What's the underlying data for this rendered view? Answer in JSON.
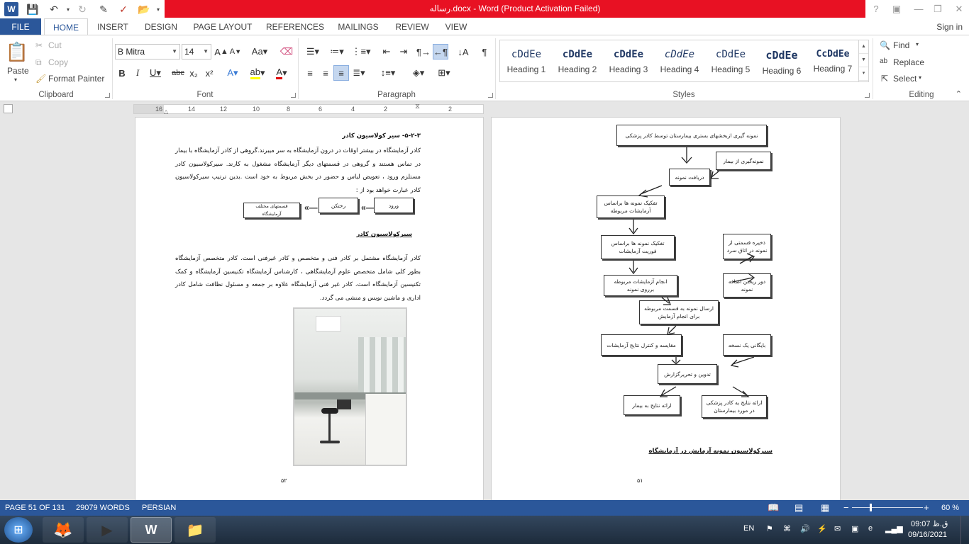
{
  "window": {
    "title": "رساله.docx -  Word (Product Activation Failed)",
    "help": "?",
    "restore_ribbon": "▣",
    "minimize": "—",
    "maximize": "❐",
    "close": "✕"
  },
  "tabs": [
    {
      "label": "FILE"
    },
    {
      "label": "HOME"
    },
    {
      "label": "INSERT"
    },
    {
      "label": "DESIGN"
    },
    {
      "label": "PAGE LAYOUT"
    },
    {
      "label": "REFERENCES"
    },
    {
      "label": "MAILINGS"
    },
    {
      "label": "REVIEW"
    },
    {
      "label": "VIEW"
    }
  ],
  "signin": "Sign in",
  "clipboard": {
    "paste": "Paste",
    "cut": "Cut",
    "copy": "Copy",
    "format_painter": "Format Painter",
    "group": "Clipboard"
  },
  "font": {
    "name": "B Mitra",
    "size": "14",
    "group": "Font"
  },
  "paragraph": {
    "group": "Paragraph"
  },
  "styles": {
    "group": "Styles",
    "items": [
      {
        "preview": "cDdEe",
        "name": "Heading 1"
      },
      {
        "preview": "cDdEe",
        "name": "Heading 2"
      },
      {
        "preview": "cDdEe",
        "name": "Heading 3"
      },
      {
        "preview": "cDdEe",
        "name": "Heading 4"
      },
      {
        "preview": "cDdEe",
        "name": "Heading 5"
      },
      {
        "preview": "cDdEe",
        "name": "Heading 6"
      },
      {
        "preview": "CcDdEe",
        "name": "Heading 7"
      }
    ]
  },
  "editing": {
    "find": "Find",
    "replace": "Replace",
    "select": "Select",
    "group": "Editing"
  },
  "ruler": {
    "numbers": [
      "16",
      "14",
      "12",
      "10",
      "8",
      "6",
      "4",
      "2",
      "2"
    ]
  },
  "doc": {
    "right_page": {
      "heading": "۵-۲-۳-     سیر کولاسیون کادر",
      "para1": "کادر آزمایشگاه در بیشتر اوقات در درون آزمایشگاه به سر میبرند.گروهی از کادر آزمایشگاه با بیمار در تماس هستند و گروهی در قسمتهای دیگر آزمایشگاه مشغول به کارند. سیرکولاسیون کادر مستلزم ورود ، تعویض لباس و حضور در بخش مربوط به خود است .بدین ترتیب سیرکولاسیون کادر عبارت خواهد بود از :",
      "flow_enter": "ورود",
      "flow_change": "رختکن",
      "flow_sections": "قسمتهای مختلف آزمایشگاه",
      "caption": "سیرکولاسیون کادر",
      "para2": "کادر آزمایشگاه مشتمل بر کادر فنی و متخصص و کادر غیرفنی است. کادر متخصص آزمایشگاه بطور کلی شامل متخصص علوم آزمایشگاهی ، کارشناس آزمایشگاه تکنیسین آزمایشگاه و کمک تکنیسین آزمایشگاه است. کادر غیر فنی آزمایشگاه علاوه بر جمعه و مسئول نظافت شامل کادر اداری و ماشین نویس و منشی می گردد.",
      "page_number": "۵۲"
    },
    "left_page": {
      "boxes": [
        "نمونه گیری ازبخشهای بستری بیمارستان توسط کادر پزشکی",
        "نمونه‌گیری از بیمار",
        "دریافت نمونه",
        "تفکیک نمونه ها براساس آزمایشات مربوطه",
        "تفکیک نمونه ها براساس فوریت آزمایشات",
        "ذخیره قسمتی از نمونه در اتاق سرد",
        "انجام آزمایشات مربوطه برروی نمونه",
        "دور ریختن اضافه نمونه",
        "ارسال نمونه به قسمت مربوطه برای انجام آزمایش",
        "مقایسه و کنترل نتایج آزمایشات",
        "بایگانی یک نسخه",
        "تدوین و تحریرگزارش",
        "ارائه نتایج به بیمار",
        "ارائه نتایج به کادر پزشکی در مورد بیمارستان"
      ],
      "caption": "سیرکولاسیون نمونه آزمایش در آزمایشگاه",
      "page_number": "۵۱"
    }
  },
  "status": {
    "page": "PAGE 51 OF 131",
    "words": "29079 WORDS",
    "language": "PERSIAN",
    "zoom": "60 %"
  },
  "taskbar": {
    "lang": "EN",
    "time": "ق.ظ 09:07",
    "date": "09/16/2021"
  },
  "colors": {
    "accent": "#2b579a",
    "title_error": "#e81123"
  }
}
